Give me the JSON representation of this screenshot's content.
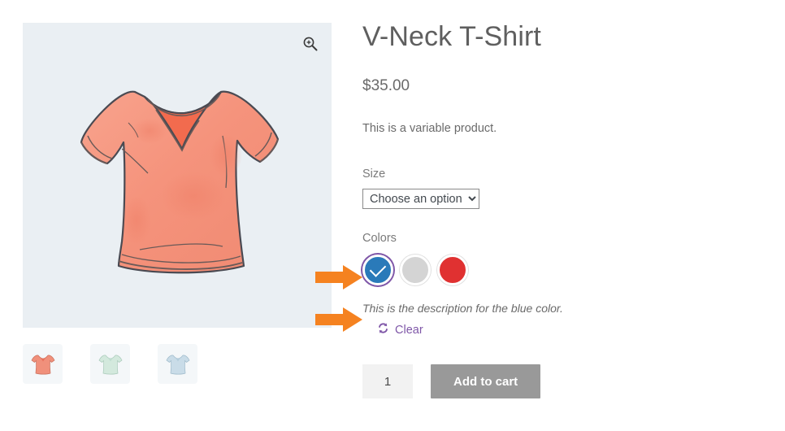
{
  "product": {
    "title": "V-Neck T-Shirt",
    "price": "$35.00",
    "short_description": "This is a variable product."
  },
  "gallery": {
    "zoom_icon": "zoom-in-icon",
    "main_image_alt": "salmon v-neck t-shirt illustration",
    "thumbnails": [
      {
        "name": "thumbnail-salmon",
        "color": "#f08c78"
      },
      {
        "name": "thumbnail-mint",
        "color": "#cfe8dd"
      },
      {
        "name": "thumbnail-blue",
        "color": "#c6dae6"
      }
    ]
  },
  "attributes": {
    "size": {
      "label": "Size",
      "selected": "Choose an option",
      "options": [
        "Choose an option"
      ]
    },
    "colors": {
      "label": "Colors",
      "swatches": [
        {
          "name": "swatch-blue",
          "color": "#2a7ab9",
          "selected": true
        },
        {
          "name": "swatch-gray",
          "color": "#d4d4d4",
          "selected": false
        },
        {
          "name": "swatch-red",
          "color": "#e03131",
          "selected": false
        }
      ],
      "description": "This is the description for the blue color.",
      "clear_label": "Clear",
      "clear_icon": "refresh-icon"
    }
  },
  "cart": {
    "quantity": "1",
    "add_to_cart_label": "Add to cart"
  },
  "annotations": {
    "arrow_color": "#f58220",
    "arrows": [
      {
        "name": "annotation-arrow-swatches"
      },
      {
        "name": "annotation-arrow-description"
      }
    ]
  },
  "colors": {
    "image_background": "#eaeff3",
    "accent_purple": "#7f57a8",
    "button_gray": "#999999"
  }
}
